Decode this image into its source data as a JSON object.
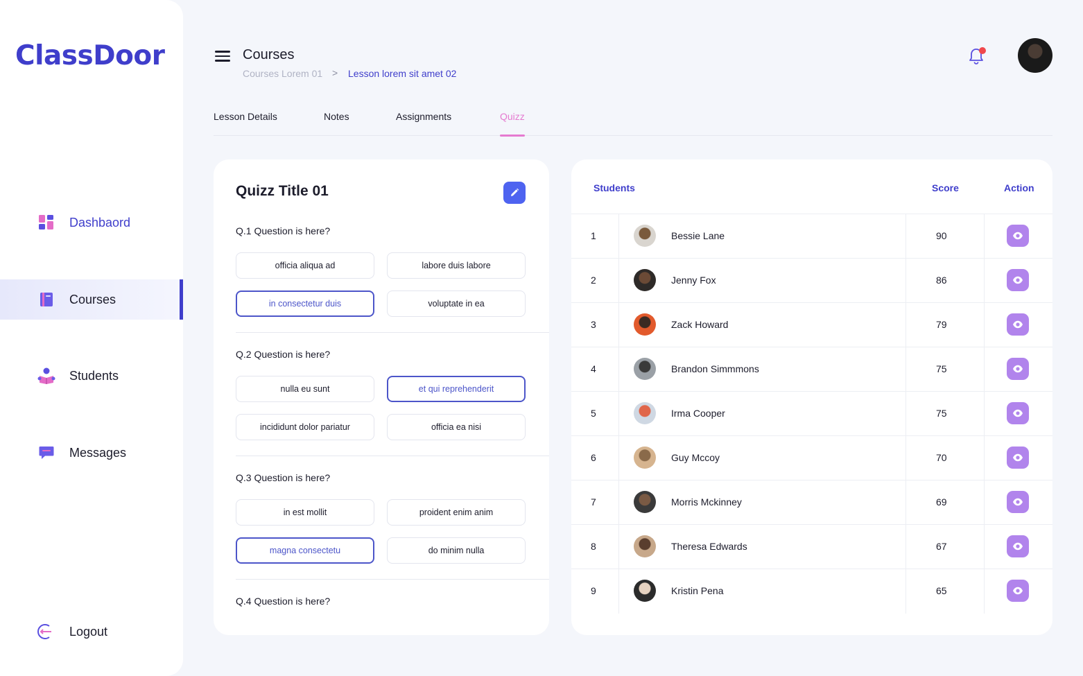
{
  "app": {
    "logo": "ClassDoor"
  },
  "sidebar": {
    "items": [
      {
        "label": "Dashbaord",
        "icon": "dashboard-icon"
      },
      {
        "label": "Courses",
        "icon": "book-icon"
      },
      {
        "label": "Students",
        "icon": "students-icon"
      },
      {
        "label": "Messages",
        "icon": "message-icon"
      }
    ],
    "logout": {
      "label": "Logout",
      "icon": "logout-icon"
    },
    "active": "Courses"
  },
  "header": {
    "title": "Courses",
    "breadcrumb": [
      "Courses Lorem 01",
      "Lesson lorem sit amet 02"
    ],
    "breadcrumb_separator": ">"
  },
  "tabs": [
    {
      "label": "Lesson Details"
    },
    {
      "label": "Notes"
    },
    {
      "label": "Assignments"
    },
    {
      "label": "Quizz"
    }
  ],
  "active_tab": "Quizz",
  "quiz": {
    "title": "Quizz Title 01",
    "questions": [
      {
        "label": "Q.1 Question is here?",
        "options": [
          "officia aliqua ad",
          "labore duis labore",
          "in consectetur duis",
          "voluptate in ea"
        ],
        "selected": "in consectetur duis"
      },
      {
        "label": "Q.2 Question is here?",
        "options": [
          "nulla eu sunt",
          "et qui reprehenderit",
          "incididunt dolor pariatur",
          "officia ea nisi"
        ],
        "selected": "et qui reprehenderit"
      },
      {
        "label": "Q.3 Question is here?",
        "options": [
          "in est mollit",
          "proident enim anim",
          "magna consectetu",
          "do minim nulla"
        ],
        "selected": "magna consectetu"
      },
      {
        "label": "Q.4 Question is here?",
        "options": []
      }
    ]
  },
  "students_table": {
    "headers": {
      "students": "Students",
      "score": "Score",
      "action": "Action"
    },
    "rows": [
      {
        "index": "1",
        "name": "Bessie Lane",
        "score": "90"
      },
      {
        "index": "2",
        "name": "Jenny Fox",
        "score": "86"
      },
      {
        "index": "3",
        "name": "Zack Howard",
        "score": "79"
      },
      {
        "index": "4",
        "name": "Brandon Simmmons",
        "score": "75"
      },
      {
        "index": "5",
        "name": "Irma Cooper",
        "score": "75"
      },
      {
        "index": "6",
        "name": "Guy Mccoy",
        "score": "70"
      },
      {
        "index": "7",
        "name": "Morris Mckinney",
        "score": "69"
      },
      {
        "index": "8",
        "name": "Theresa Edwards",
        "score": "67"
      },
      {
        "index": "9",
        "name": "Kristin Pena",
        "score": "65"
      }
    ]
  },
  "colors": {
    "accent": "#3f3ecb",
    "tab_active": "#e57ad0",
    "action_button": "#b184ec",
    "edit_button": "#4e63f0",
    "notification_dot": "#f0484c"
  }
}
